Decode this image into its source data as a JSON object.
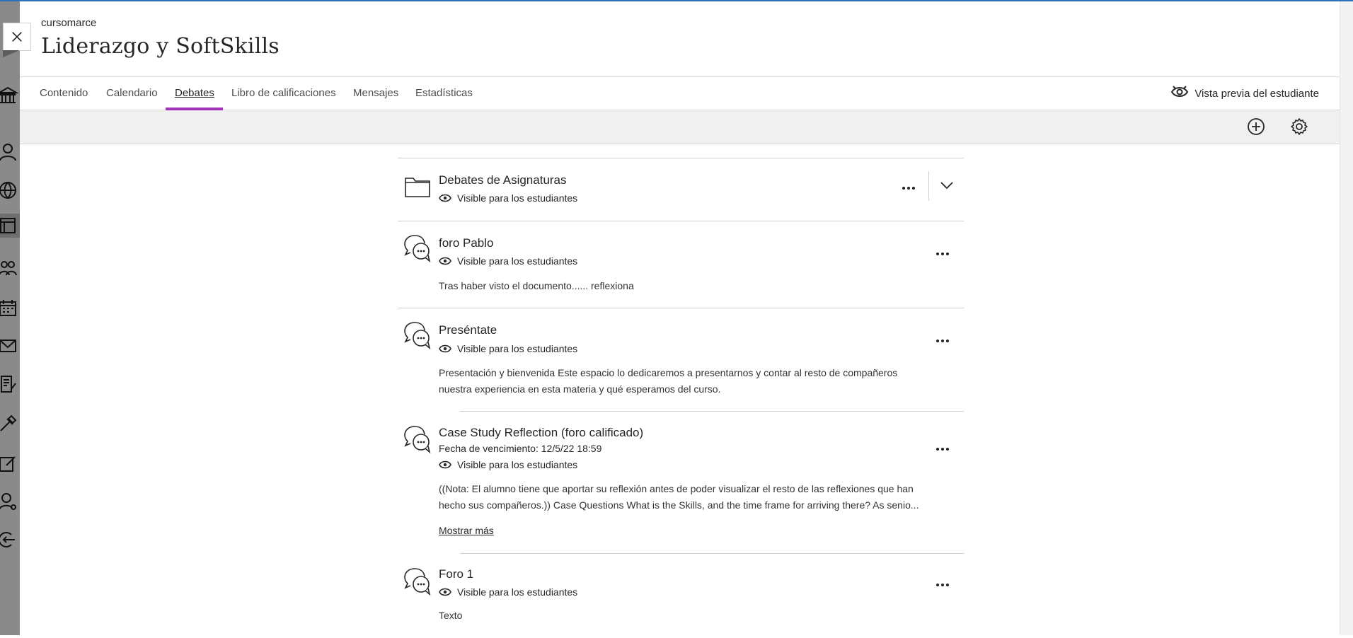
{
  "course": {
    "org": "cursomarce",
    "title": "Liderazgo y SoftSkills"
  },
  "nav": {
    "tabs": [
      {
        "label": "Contenido"
      },
      {
        "label": "Calendario"
      },
      {
        "label": "Debates",
        "active": true
      },
      {
        "label": "Libro de calificaciones"
      },
      {
        "label": "Mensajes"
      },
      {
        "label": "Estadísticas"
      }
    ],
    "student_preview": "Vista previa del estudiante"
  },
  "toolbar": {
    "add_icon": "plus-circle-icon",
    "settings_icon": "gear-icon"
  },
  "rail": {
    "icons": [
      "institution-icon",
      "person-icon",
      "globe-icon",
      "courses-icon",
      "groups-icon",
      "calendar-icon",
      "mail-icon",
      "grades-icon",
      "tools-icon",
      "edit-icon",
      "user-settings-icon",
      "sign-out-icon"
    ]
  },
  "colors": {
    "accent": "#a235b5",
    "topline": "#2f6fb3"
  },
  "discussions": {
    "folder": {
      "title": "Debates de Asignaturas",
      "visibility": "Visible para los estudiantes"
    },
    "items": [
      {
        "title": "foro Pablo",
        "visibility": "Visible para los estudiantes",
        "description": "Tras haber visto el documento...... reflexiona"
      },
      {
        "title": "Preséntate",
        "visibility": "Visible para los estudiantes",
        "description_line1": "Presentación y bienvenida Este espacio lo dedicaremos a presentarnos y contar al resto de compañeros",
        "description_line2": "nuestra experiencia en esta materia y qué esperamos del curso."
      },
      {
        "title": "Case Study Reflection (foro calificado)",
        "due": "Fecha de vencimiento: 12/5/22 18:59",
        "visibility": "Visible para los estudiantes",
        "description_line1": "((Nota: El alumno tiene que aportar su reflexión antes de poder visualizar el resto de las reflexiones que han",
        "description_line2": "hecho sus compañeros.)) Case Questions What is the Skills, and the time frame for arriving there? As senio...",
        "show_more": "Mostrar más"
      },
      {
        "title": "Foro 1",
        "visibility": "Visible para los estudiantes",
        "description": "Texto"
      }
    ]
  }
}
